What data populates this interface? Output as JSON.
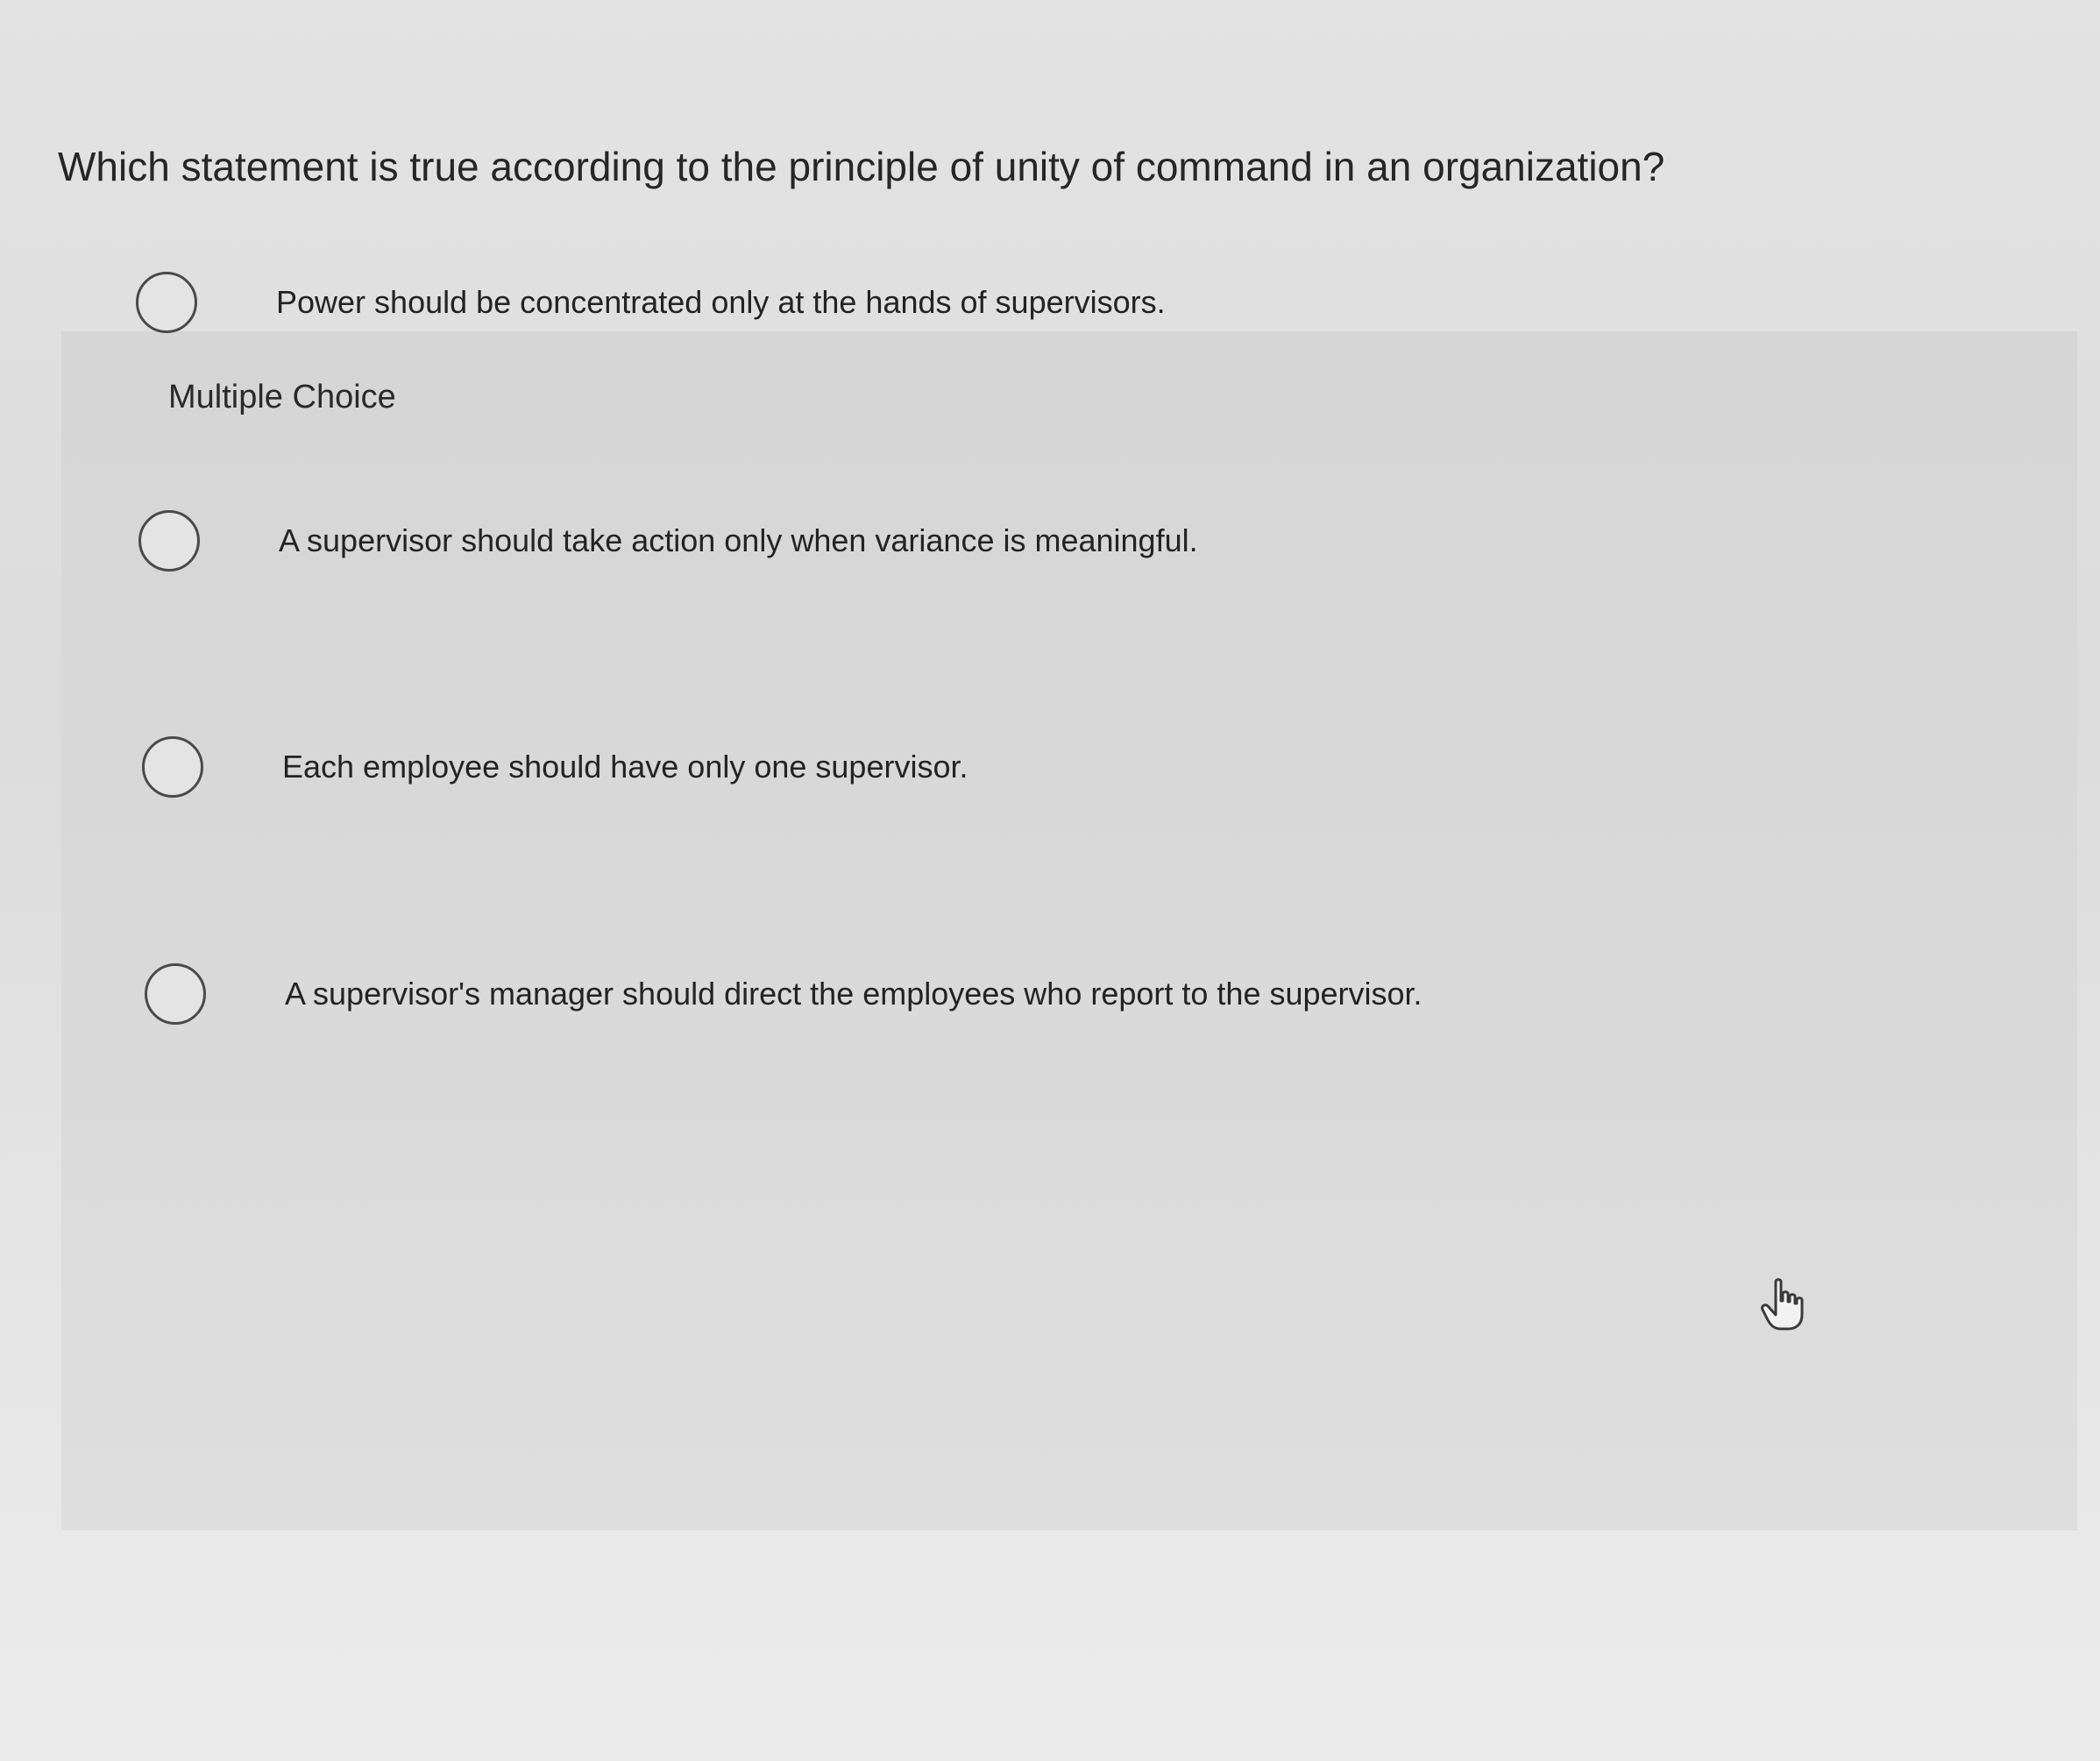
{
  "question": {
    "text": "Which statement is true according to the principle of unity of command in an organization?"
  },
  "panel": {
    "label": "Multiple Choice"
  },
  "options": [
    {
      "label": "Power should be concentrated only at the hands of supervisors.",
      "selected": false
    },
    {
      "label": "A supervisor should take action only when variance is meaningful.",
      "selected": false
    },
    {
      "label": "Each employee should have only one supervisor.",
      "selected": false
    },
    {
      "label": "A supervisor's manager should direct the employees who report to the supervisor.",
      "selected": false
    }
  ],
  "cursor": {
    "icon": "hand-pointer-icon"
  }
}
